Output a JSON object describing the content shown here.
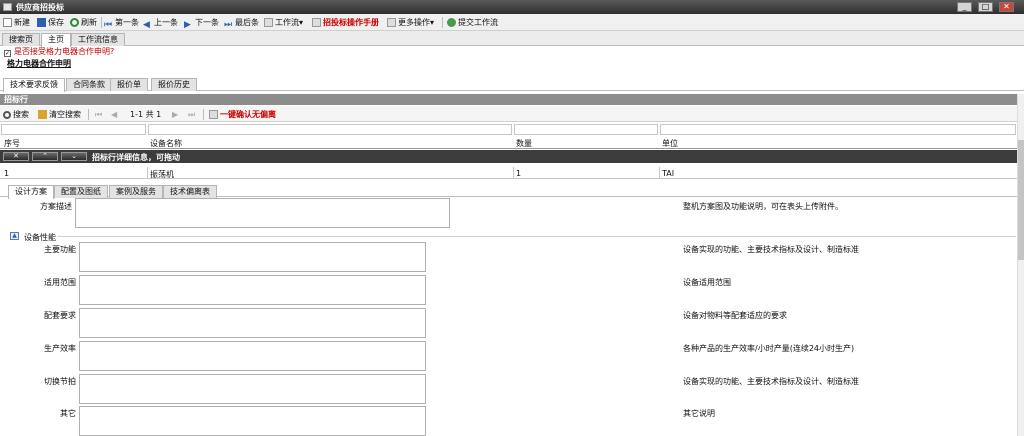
{
  "window": {
    "title": "供应商招投标"
  },
  "toolbar": {
    "new": "新建",
    "save": "保存",
    "refresh": "刷新",
    "first": "第一条",
    "prev": "上一条",
    "next": "下一条",
    "last": "最后条",
    "workflow": "工作流",
    "manual": "招投标操作手册",
    "more": "更多操作",
    "submit": "提交工作流"
  },
  "top_tabs": [
    "搜索页",
    "主页",
    "工作流信息"
  ],
  "warning": "是否接受格力电器合作申明?",
  "agreement": "格力电器合作申明",
  "sub_tabs": [
    "技术要求反馈",
    "合同条款",
    "报价单",
    "报价历史"
  ],
  "section_title": "招标行",
  "pager": {
    "search": "搜索",
    "clear": "清空搜索",
    "range": "1-1 共 1",
    "confirm": "一键确认无偏离"
  },
  "columns": [
    "序号",
    "设备名称",
    "数量",
    "单位"
  ],
  "detail_bar": {
    "close": "✕",
    "up": "⌃",
    "down": "⌄",
    "title": "招标行详细信息，可拖动"
  },
  "row": {
    "no": "1",
    "name": "振荡机",
    "qty": "1",
    "unit": "TAI"
  },
  "detail_tabs": [
    "设计方案",
    "配置及图纸",
    "案例及服务",
    "技术偏离表"
  ],
  "form": {
    "scheme_label": "方案描述",
    "scheme_hint": "整机方案图及功能说明，可在表头上传附件。",
    "group_title": "设备性能",
    "fields": [
      {
        "label": "主要功能",
        "hint": "设备实现的功能、主要技术指标及设计、制造标准"
      },
      {
        "label": "适用范围",
        "hint": "设备适用范围"
      },
      {
        "label": "配套要求",
        "hint": "设备对物料等配套适应的要求"
      },
      {
        "label": "生产效率",
        "hint": "各种产品的生产效率/小时产量(连续24小时生产)"
      },
      {
        "label": "切换节拍",
        "hint": "设备实现的功能、主要技术指标及设计、制造标准"
      },
      {
        "label": "其它",
        "hint": "其它说明"
      }
    ]
  },
  "colors": {
    "title_bar": "#3a3a3a",
    "section_bar": "#8c8c8c",
    "warning": "#d00000",
    "accent_red": "#cc0000"
  }
}
